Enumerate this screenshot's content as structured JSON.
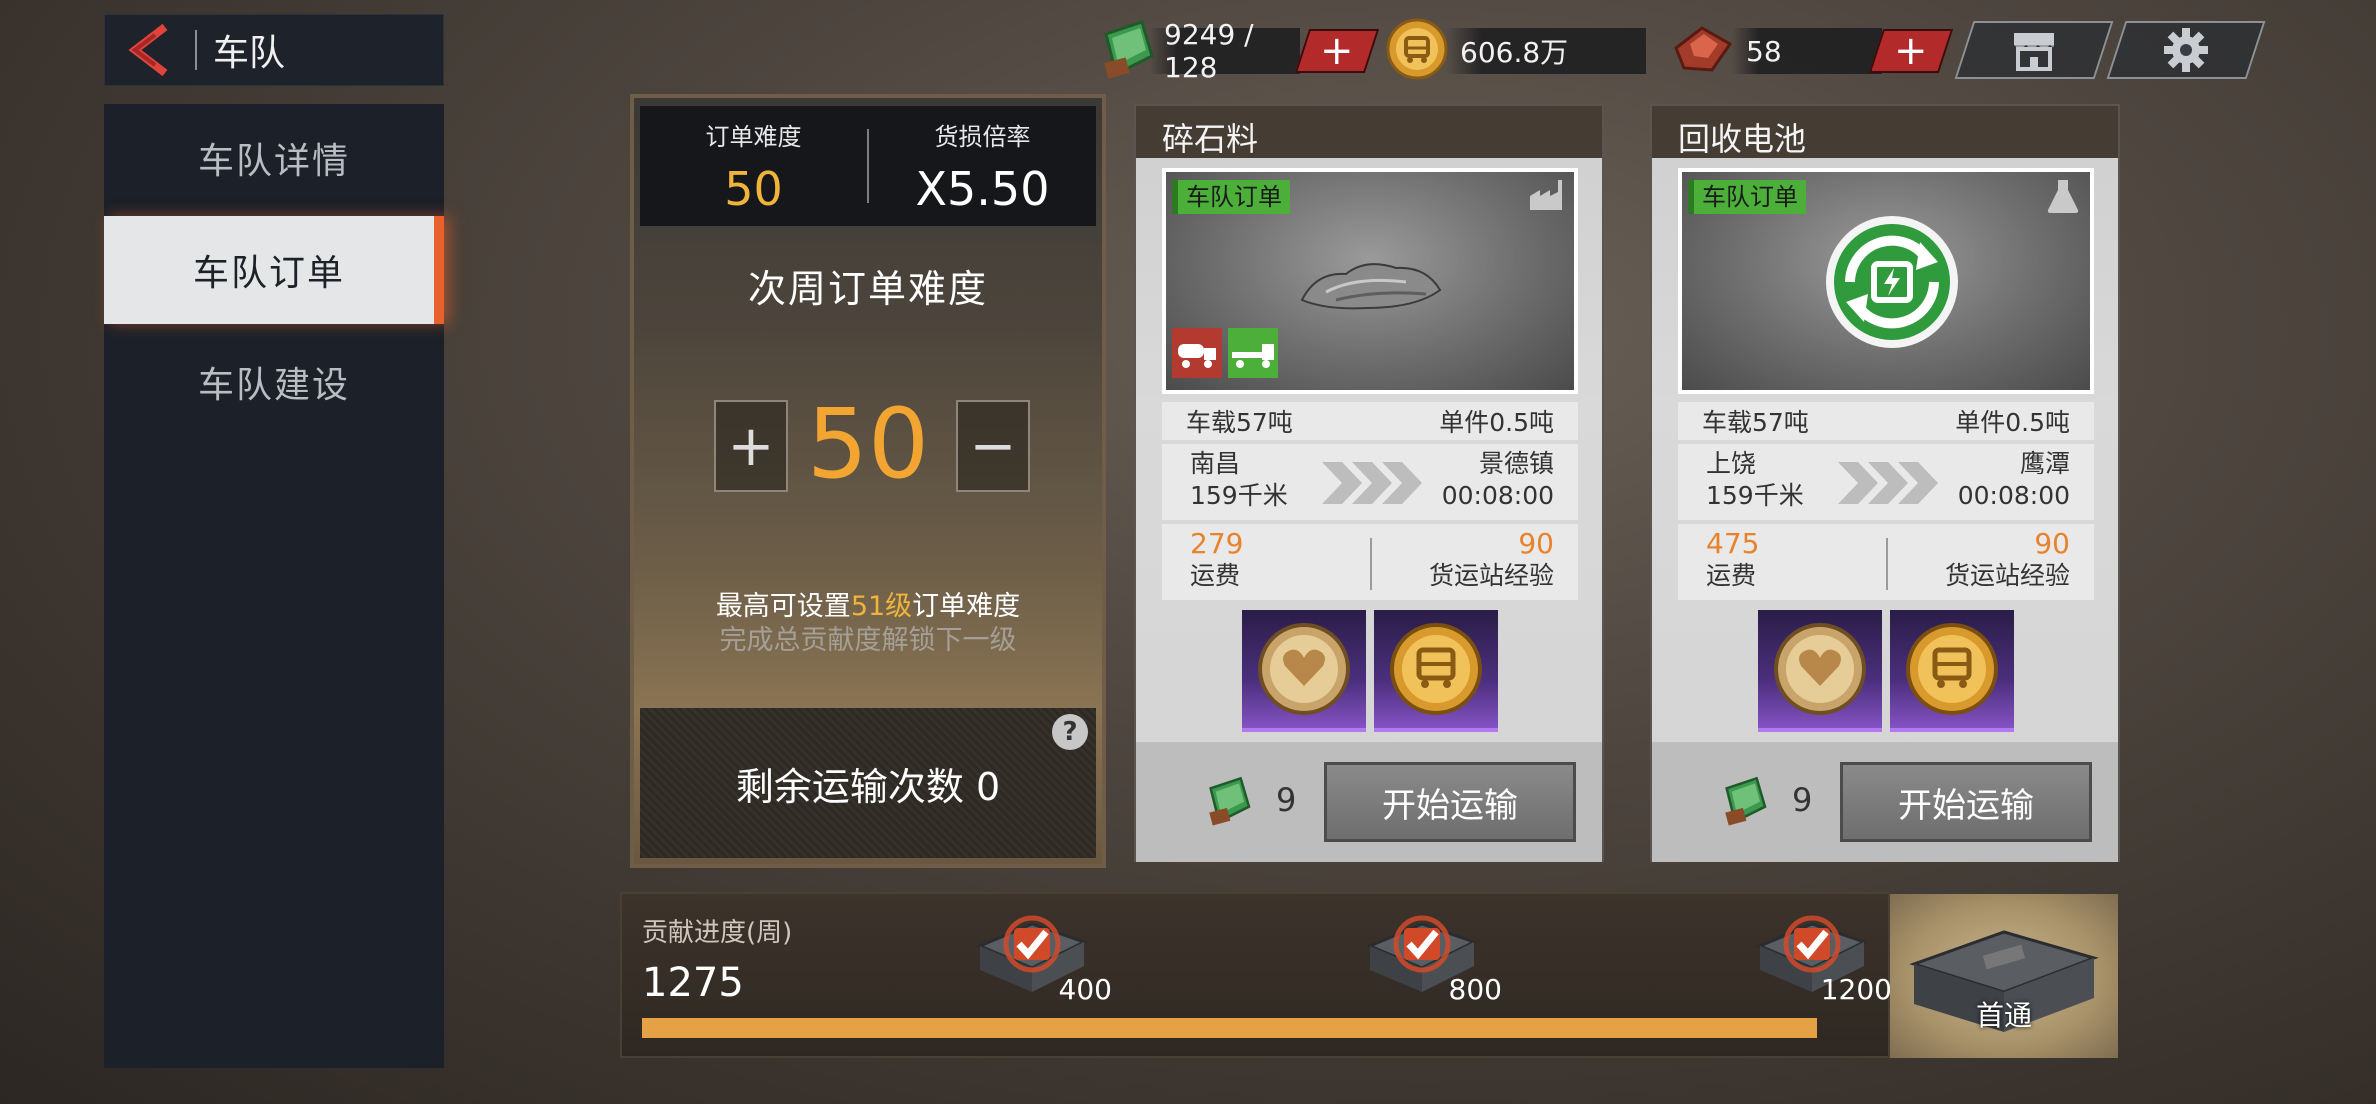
{
  "header": {
    "title": "车队"
  },
  "sidebar": {
    "items": [
      {
        "label": "车队详情"
      },
      {
        "label": "车队订单"
      },
      {
        "label": "车队建设"
      }
    ],
    "active_index": 1
  },
  "resources": {
    "stamina": "9249 / 128",
    "coins": "606.8万",
    "gems": "58"
  },
  "difficulty": {
    "order_difficulty_label": "订单难度",
    "order_difficulty_value": "50",
    "damage_rate_label": "货损倍率",
    "damage_rate_value": "X5.50",
    "next_week_title": "次周订单难度",
    "next_week_value": "50",
    "plus_label": "+",
    "minus_label": "−",
    "hint_prefix": "最高可设置",
    "hint_level": "51级",
    "hint_suffix": "订单难度",
    "hint_unlock": "完成总贡献度解锁下一级",
    "remaining_label": "剩余运输次数 0",
    "help_label": "?"
  },
  "orders": [
    {
      "title": "碎石料",
      "tag": "车队订单",
      "load": "车载57吨",
      "unit": "单件0.5吨",
      "from": "南昌",
      "distance": "159千米",
      "to": "景德镇",
      "time": "00:08:00",
      "fee_value": "279",
      "fee_label": "运费",
      "exp_value": "90",
      "exp_label": "货运站经验",
      "cost": "9",
      "start_label": "开始运输"
    },
    {
      "title": "回收电池",
      "tag": "车队订单",
      "load": "车载57吨",
      "unit": "单件0.5吨",
      "from": "上饶",
      "distance": "159千米",
      "to": "鹰潭",
      "time": "00:08:00",
      "fee_value": "475",
      "fee_label": "运费",
      "exp_value": "90",
      "exp_label": "货运站经验",
      "cost": "9",
      "start_label": "开始运输"
    }
  ],
  "contribution": {
    "label": "贡献进度(周)",
    "value": "1275",
    "progress_max": 1275,
    "progress_current": 1275,
    "milestones": [
      "400",
      "800",
      "1200"
    ],
    "first_clear_label": "首通"
  },
  "colors": {
    "accent_orange": "#e8602c",
    "gold": "#f0b43a",
    "order_tag_green": "#4caf3a",
    "plus_red": "#b32a2a"
  },
  "icons": [
    "back-arrow-icon",
    "stamina-icon",
    "coin-icon",
    "gem-icon",
    "shop-icon",
    "gear-icon",
    "factory-icon",
    "flask-icon",
    "heart-medal-icon",
    "bus-medal-icon",
    "checkmark-icon",
    "crate-icon"
  ]
}
